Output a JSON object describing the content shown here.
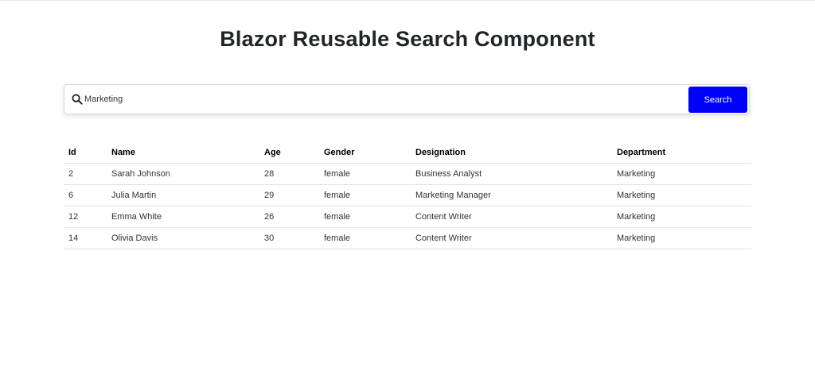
{
  "page": {
    "title": "Blazor Reusable Search Component"
  },
  "search": {
    "value": "Marketing",
    "button_label": "Search",
    "button_color": "#0000ff"
  },
  "table": {
    "headers": [
      "Id",
      "Name",
      "Age",
      "Gender",
      "Designation",
      "Department"
    ],
    "rows": [
      [
        "2",
        "Sarah Johnson",
        "28",
        "female",
        "Business Analyst",
        "Marketing"
      ],
      [
        "6",
        "Julia Martin",
        "29",
        "female",
        "Marketing Manager",
        "Marketing"
      ],
      [
        "12",
        "Emma White",
        "26",
        "female",
        "Content Writer",
        "Marketing"
      ],
      [
        "14",
        "Olivia Davis",
        "30",
        "female",
        "Content Writer",
        "Marketing"
      ]
    ]
  }
}
